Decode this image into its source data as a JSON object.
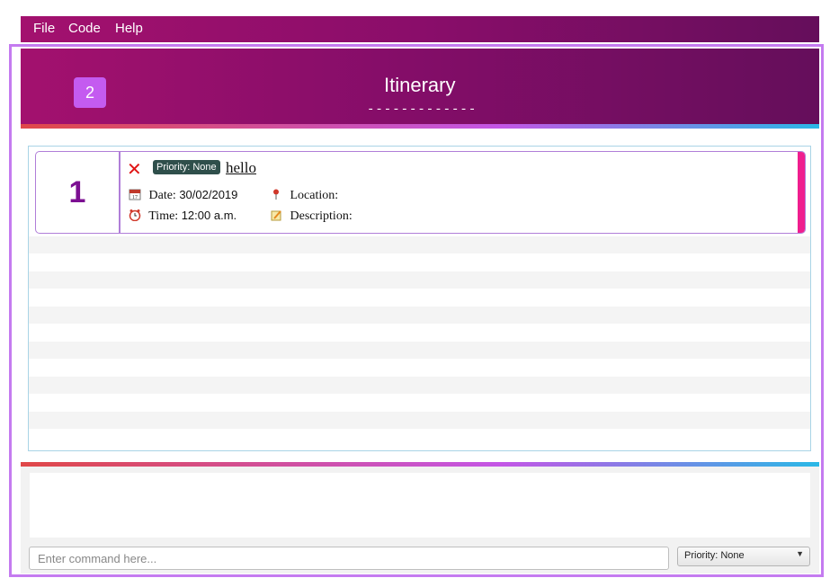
{
  "menu": {
    "file": "File",
    "code": "Code",
    "help": "Help"
  },
  "header": {
    "count_badge": "2",
    "title": "Itinerary",
    "underline": "-------------"
  },
  "items": [
    {
      "index": "1",
      "priority_label": "Priority: None",
      "name": "hello",
      "date_label": "Date:",
      "date_value": "30/02/2019",
      "time_label": "Time:",
      "time_value": "12:00 a.m.",
      "location_label": "Location:",
      "location_value": "",
      "description_label": "Description:",
      "description_value": ""
    }
  ],
  "command": {
    "placeholder": "Enter command here..."
  },
  "priority_select": {
    "selected": "Priority: None"
  },
  "colors": {
    "header_gradient_start": "#a3116e",
    "header_gradient_end": "#650e5b",
    "badge": "#c45bf0",
    "index_text": "#7c0f92",
    "priority_tag": "#2f4f4b",
    "accent_bar": "#ef1e8e",
    "frame": "#c47bf0"
  },
  "icons": [
    "delete-icon",
    "calendar-icon",
    "clock-icon",
    "location-pin-icon",
    "memo-icon",
    "chevron-down-icon"
  ]
}
